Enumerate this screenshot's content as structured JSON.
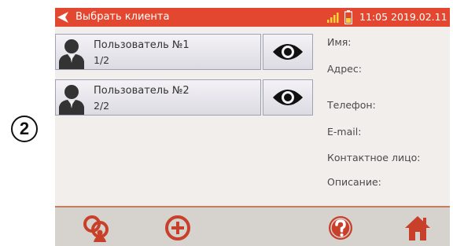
{
  "step_number": "2",
  "titlebar": {
    "title": "Выбрать клиента",
    "clock": "11:05 2019.02.11",
    "back_icon": "back-arrow-icon",
    "signal_icon": "signal-icon",
    "battery_icon": "battery-icon"
  },
  "clients": [
    {
      "name": "Пользователь №1",
      "count": "1/2"
    },
    {
      "name": "Пользователь №2",
      "count": "2/2"
    }
  ],
  "details": {
    "name_label": "Имя:",
    "address_label": "Адрес:",
    "phone_label": "Телефон:",
    "email_label": "E-mail:",
    "contact_label": "Контактное лицо:",
    "description_label": "Описание:"
  },
  "toolbar": {
    "icons": [
      "client-search-icon",
      "add-icon",
      "help-icon",
      "home-icon"
    ]
  },
  "colors": {
    "titlebar": "#e4472f",
    "screen_bg": "#f1eeec",
    "toolbar_bg": "#d6d2ce",
    "icon_red": "#c8402a"
  }
}
